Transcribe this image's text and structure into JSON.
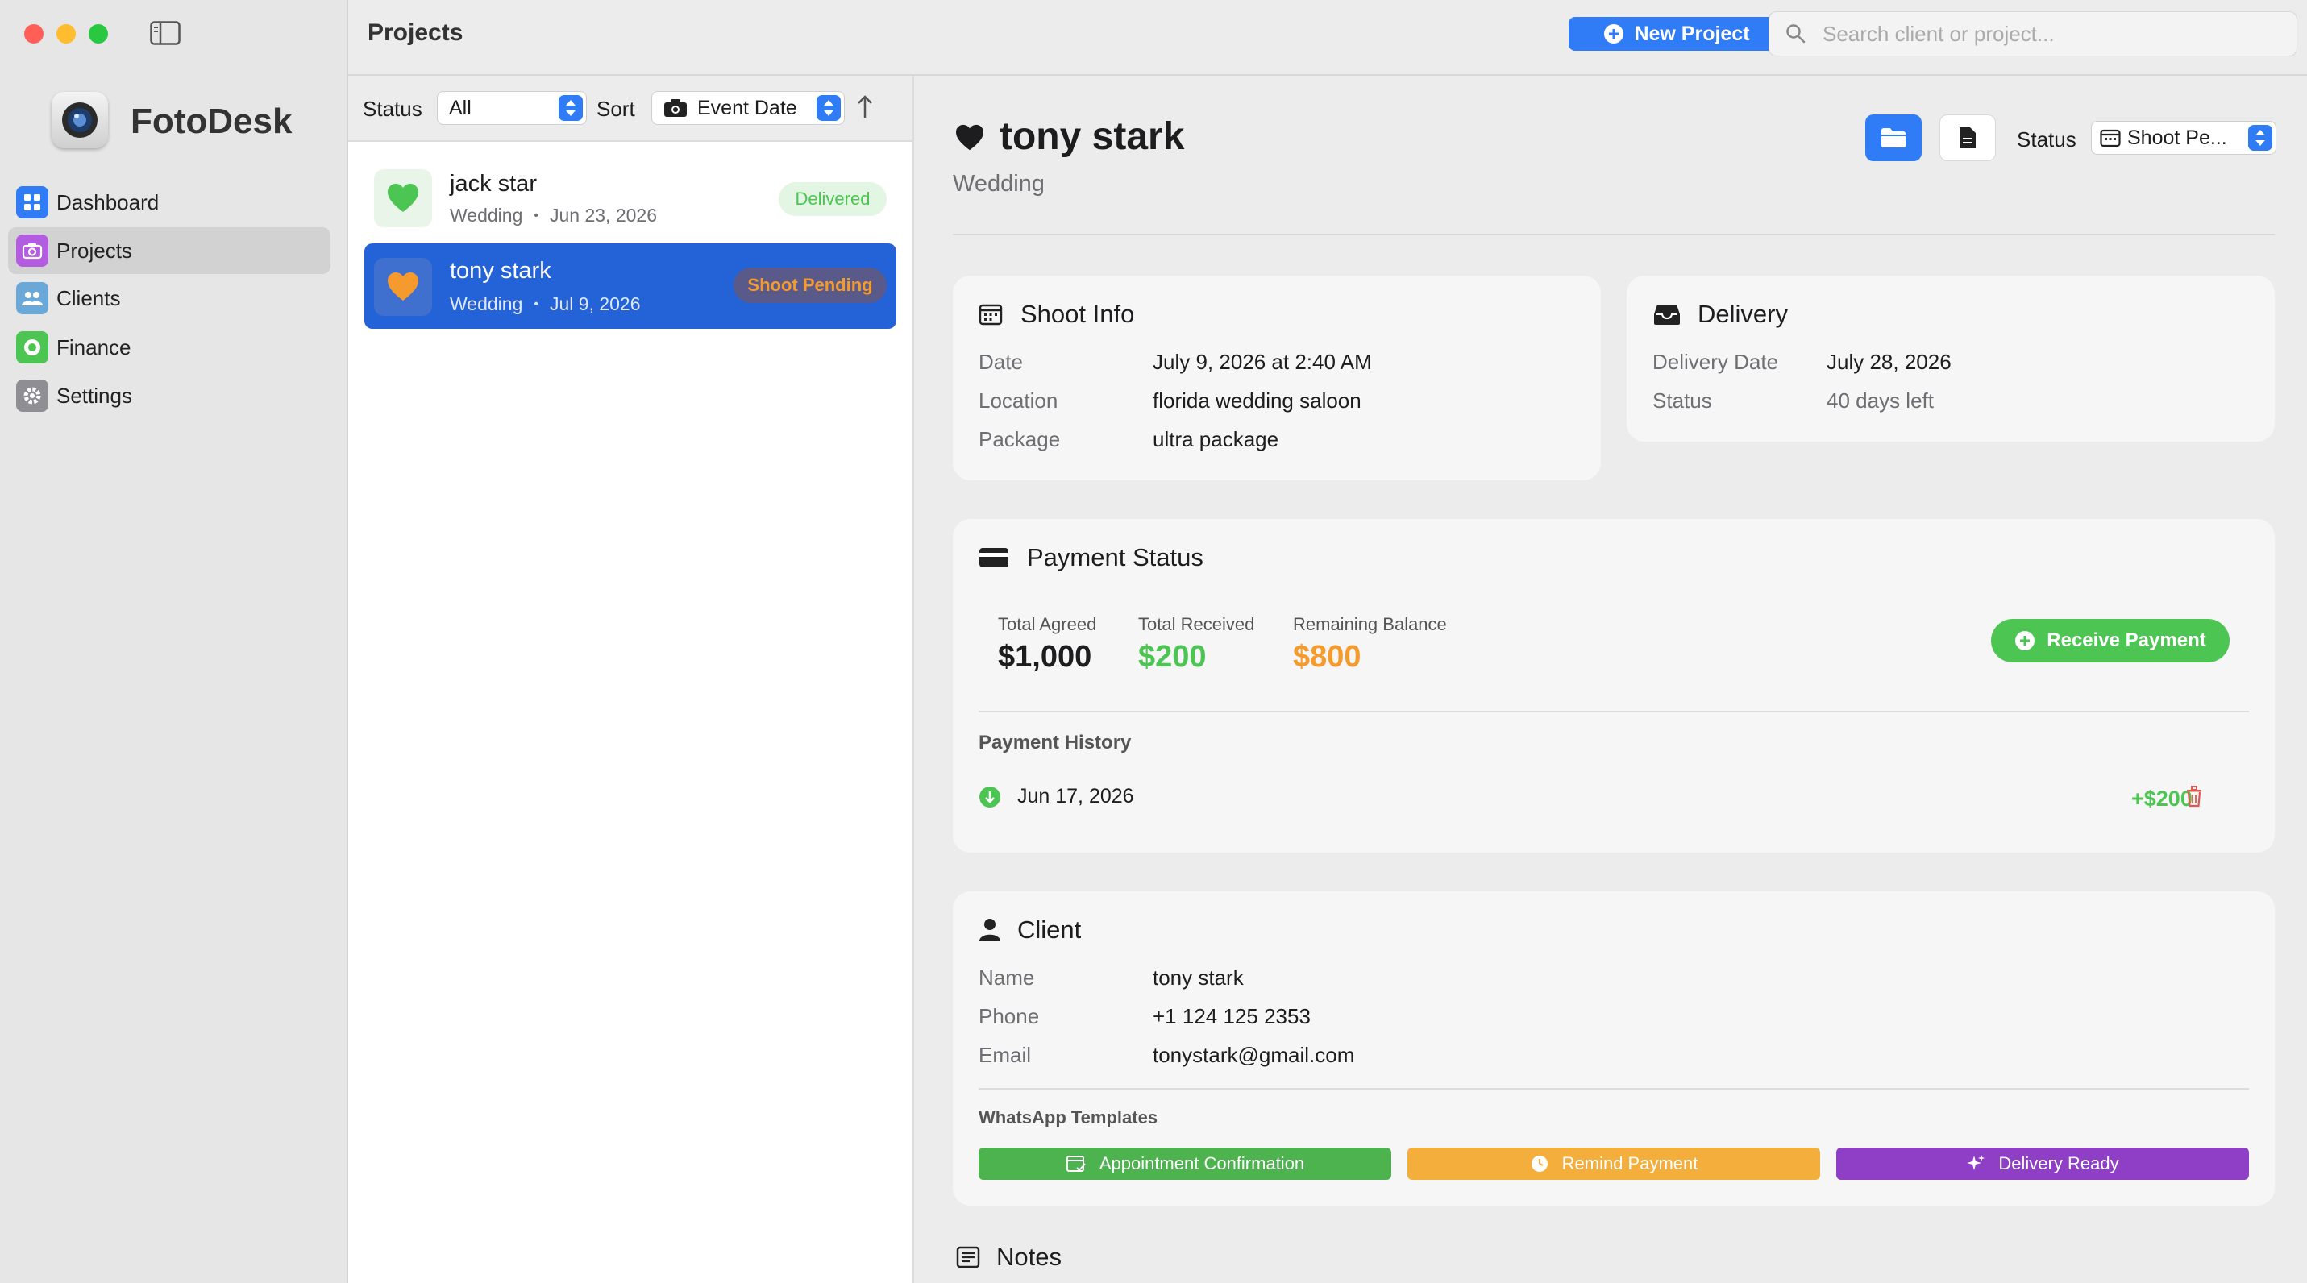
{
  "app": {
    "name": "FotoDesk",
    "colors": {
      "accent": "#2f7cf6",
      "green": "#4cc552",
      "orange": "#f59a2c",
      "purple": "#8e3fc6"
    }
  },
  "sidebar": {
    "items": [
      {
        "label": "Dashboard",
        "icon": "grid-icon",
        "color": "#2f7cf6"
      },
      {
        "label": "Projects",
        "icon": "camera-icon",
        "color": "#b45ce0"
      },
      {
        "label": "Clients",
        "icon": "people-icon",
        "color": "#6aa8d8"
      },
      {
        "label": "Finance",
        "icon": "coin-icon",
        "color": "#4cc552"
      },
      {
        "label": "Settings",
        "icon": "gear-icon",
        "color": "#8e8e93"
      }
    ]
  },
  "topbar": {
    "title": "Projects",
    "new_project": "New Project",
    "search_placeholder": "Search client or project..."
  },
  "filters": {
    "status_label": "Status",
    "status_value": "All",
    "sort_label": "Sort",
    "sort_value": "Event Date"
  },
  "projects": [
    {
      "name": "jack star",
      "type": "Wedding",
      "date": "Jun 23, 2026",
      "badge": "Delivered"
    },
    {
      "name": "tony stark",
      "type": "Wedding",
      "date": "Jul 9, 2026",
      "badge": "Shoot Pending"
    }
  ],
  "detail": {
    "name": "tony stark",
    "type": "Wedding",
    "status_label": "Status",
    "status_value": "Shoot Pe...",
    "shoot_info": {
      "title": "Shoot Info",
      "rows": [
        {
          "label": "Date",
          "value": "July 9, 2026 at 2:40 AM"
        },
        {
          "label": "Location",
          "value": "florida wedding saloon"
        },
        {
          "label": "Package",
          "value": "ultra package"
        }
      ]
    },
    "delivery": {
      "title": "Delivery",
      "rows": [
        {
          "label": "Delivery Date",
          "value": "July 28, 2026"
        },
        {
          "label": "Status",
          "value": "40 days left"
        }
      ]
    },
    "payment": {
      "title": "Payment Status",
      "agreed_label": "Total Agreed",
      "agreed": "$1,000",
      "received_label": "Total Received",
      "received": "$200",
      "remaining_label": "Remaining Balance",
      "remaining": "$800",
      "receive_button": "Receive Payment",
      "history_title": "Payment History",
      "history": [
        {
          "date": "Jun 17, 2026",
          "amount": "+$200"
        }
      ]
    },
    "client": {
      "title": "Client",
      "rows": [
        {
          "label": "Name",
          "value": "tony stark"
        },
        {
          "label": "Phone",
          "value": "+1 124 125 2353"
        },
        {
          "label": "Email",
          "value": "tonystark@gmail.com"
        }
      ],
      "wa_title": "WhatsApp Templates",
      "wa_buttons": [
        "Appointment Confirmation",
        "Remind Payment",
        "Delivery Ready"
      ]
    },
    "notes_title": "Notes"
  }
}
